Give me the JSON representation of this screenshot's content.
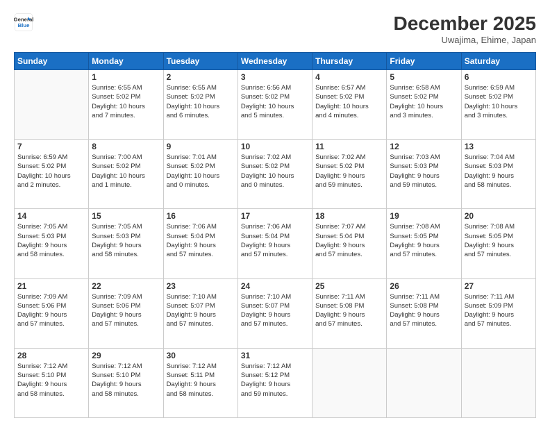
{
  "header": {
    "logo_line1": "General",
    "logo_line2": "Blue",
    "month": "December 2025",
    "location": "Uwajima, Ehime, Japan"
  },
  "weekdays": [
    "Sunday",
    "Monday",
    "Tuesday",
    "Wednesday",
    "Thursday",
    "Friday",
    "Saturday"
  ],
  "weeks": [
    [
      {
        "day": "",
        "info": ""
      },
      {
        "day": "1",
        "info": "Sunrise: 6:55 AM\nSunset: 5:02 PM\nDaylight: 10 hours\nand 7 minutes."
      },
      {
        "day": "2",
        "info": "Sunrise: 6:55 AM\nSunset: 5:02 PM\nDaylight: 10 hours\nand 6 minutes."
      },
      {
        "day": "3",
        "info": "Sunrise: 6:56 AM\nSunset: 5:02 PM\nDaylight: 10 hours\nand 5 minutes."
      },
      {
        "day": "4",
        "info": "Sunrise: 6:57 AM\nSunset: 5:02 PM\nDaylight: 10 hours\nand 4 minutes."
      },
      {
        "day": "5",
        "info": "Sunrise: 6:58 AM\nSunset: 5:02 PM\nDaylight: 10 hours\nand 3 minutes."
      },
      {
        "day": "6",
        "info": "Sunrise: 6:59 AM\nSunset: 5:02 PM\nDaylight: 10 hours\nand 3 minutes."
      }
    ],
    [
      {
        "day": "7",
        "info": "Sunrise: 6:59 AM\nSunset: 5:02 PM\nDaylight: 10 hours\nand 2 minutes."
      },
      {
        "day": "8",
        "info": "Sunrise: 7:00 AM\nSunset: 5:02 PM\nDaylight: 10 hours\nand 1 minute."
      },
      {
        "day": "9",
        "info": "Sunrise: 7:01 AM\nSunset: 5:02 PM\nDaylight: 10 hours\nand 0 minutes."
      },
      {
        "day": "10",
        "info": "Sunrise: 7:02 AM\nSunset: 5:02 PM\nDaylight: 10 hours\nand 0 minutes."
      },
      {
        "day": "11",
        "info": "Sunrise: 7:02 AM\nSunset: 5:02 PM\nDaylight: 9 hours\nand 59 minutes."
      },
      {
        "day": "12",
        "info": "Sunrise: 7:03 AM\nSunset: 5:03 PM\nDaylight: 9 hours\nand 59 minutes."
      },
      {
        "day": "13",
        "info": "Sunrise: 7:04 AM\nSunset: 5:03 PM\nDaylight: 9 hours\nand 58 minutes."
      }
    ],
    [
      {
        "day": "14",
        "info": "Sunrise: 7:05 AM\nSunset: 5:03 PM\nDaylight: 9 hours\nand 58 minutes."
      },
      {
        "day": "15",
        "info": "Sunrise: 7:05 AM\nSunset: 5:03 PM\nDaylight: 9 hours\nand 58 minutes."
      },
      {
        "day": "16",
        "info": "Sunrise: 7:06 AM\nSunset: 5:04 PM\nDaylight: 9 hours\nand 57 minutes."
      },
      {
        "day": "17",
        "info": "Sunrise: 7:06 AM\nSunset: 5:04 PM\nDaylight: 9 hours\nand 57 minutes."
      },
      {
        "day": "18",
        "info": "Sunrise: 7:07 AM\nSunset: 5:04 PM\nDaylight: 9 hours\nand 57 minutes."
      },
      {
        "day": "19",
        "info": "Sunrise: 7:08 AM\nSunset: 5:05 PM\nDaylight: 9 hours\nand 57 minutes."
      },
      {
        "day": "20",
        "info": "Sunrise: 7:08 AM\nSunset: 5:05 PM\nDaylight: 9 hours\nand 57 minutes."
      }
    ],
    [
      {
        "day": "21",
        "info": "Sunrise: 7:09 AM\nSunset: 5:06 PM\nDaylight: 9 hours\nand 57 minutes."
      },
      {
        "day": "22",
        "info": "Sunrise: 7:09 AM\nSunset: 5:06 PM\nDaylight: 9 hours\nand 57 minutes."
      },
      {
        "day": "23",
        "info": "Sunrise: 7:10 AM\nSunset: 5:07 PM\nDaylight: 9 hours\nand 57 minutes."
      },
      {
        "day": "24",
        "info": "Sunrise: 7:10 AM\nSunset: 5:07 PM\nDaylight: 9 hours\nand 57 minutes."
      },
      {
        "day": "25",
        "info": "Sunrise: 7:11 AM\nSunset: 5:08 PM\nDaylight: 9 hours\nand 57 minutes."
      },
      {
        "day": "26",
        "info": "Sunrise: 7:11 AM\nSunset: 5:08 PM\nDaylight: 9 hours\nand 57 minutes."
      },
      {
        "day": "27",
        "info": "Sunrise: 7:11 AM\nSunset: 5:09 PM\nDaylight: 9 hours\nand 57 minutes."
      }
    ],
    [
      {
        "day": "28",
        "info": "Sunrise: 7:12 AM\nSunset: 5:10 PM\nDaylight: 9 hours\nand 58 minutes."
      },
      {
        "day": "29",
        "info": "Sunrise: 7:12 AM\nSunset: 5:10 PM\nDaylight: 9 hours\nand 58 minutes."
      },
      {
        "day": "30",
        "info": "Sunrise: 7:12 AM\nSunset: 5:11 PM\nDaylight: 9 hours\nand 58 minutes."
      },
      {
        "day": "31",
        "info": "Sunrise: 7:12 AM\nSunset: 5:12 PM\nDaylight: 9 hours\nand 59 minutes."
      },
      {
        "day": "",
        "info": ""
      },
      {
        "day": "",
        "info": ""
      },
      {
        "day": "",
        "info": ""
      }
    ]
  ]
}
